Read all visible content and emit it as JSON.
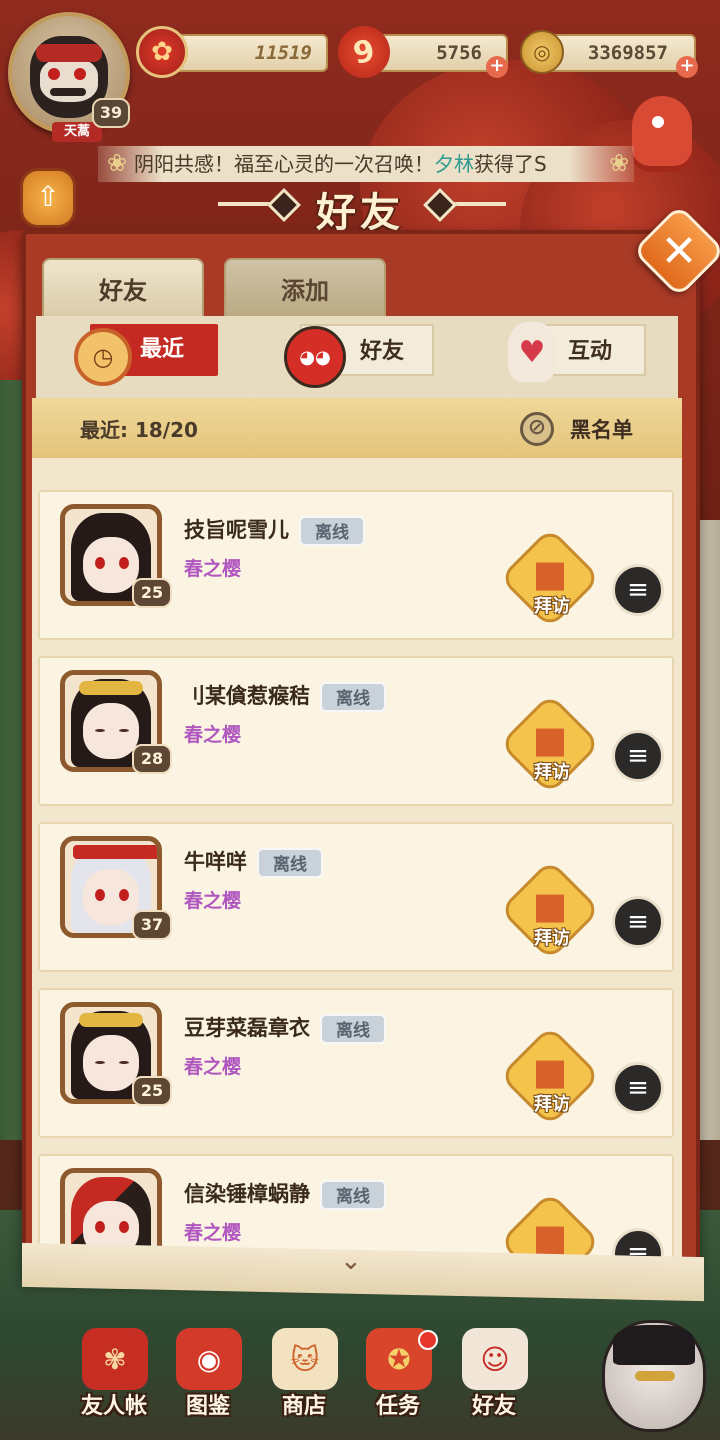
{
  "player": {
    "level": "39",
    "badge_text": "天蒿"
  },
  "resources": {
    "stamina": "11519",
    "magatama": "5756",
    "coins": "3369857",
    "magatama_glyph": "9",
    "coin_glyph": "◎",
    "plus": "+"
  },
  "ticker": {
    "text_before": "阴阳共感！福至心灵的一次召唤！",
    "highlight": "夕林",
    "text_after": "获得了S"
  },
  "title": "好友",
  "tabs": [
    {
      "label": "好友"
    },
    {
      "label": "添加"
    }
  ],
  "segments": [
    {
      "label": "最近",
      "icon": "clock-icon",
      "active": true
    },
    {
      "label": "好友",
      "icon": "daruma-icon",
      "active": false
    },
    {
      "label": "互动",
      "icon": "doll-icon",
      "active": false
    }
  ],
  "recent": {
    "label": "最近:  18/20",
    "blacklist_label": "黑名单"
  },
  "friends": [
    {
      "name": "技旨呢雪儿",
      "status": "离线",
      "guild": "春之樱",
      "level": "25"
    },
    {
      "name": "刂某僋惹瘊秸",
      "status": "离线",
      "guild": "春之樱",
      "level": "28"
    },
    {
      "name": "牛咩咩",
      "status": "离线",
      "guild": "春之樱",
      "level": "37"
    },
    {
      "name": "豆芽菜磊章衣",
      "status": "离线",
      "guild": "春之樱",
      "level": "25"
    },
    {
      "name": "信染锤樟蜗静",
      "status": "离线",
      "guild": "春之樱",
      "level": ""
    }
  ],
  "visit_label": "拜访",
  "nav": [
    {
      "label": "友人帐"
    },
    {
      "label": "图鉴"
    },
    {
      "label": "商店"
    },
    {
      "label": "任务"
    },
    {
      "label": "好友"
    }
  ],
  "colors": {
    "panel": "#a83a26",
    "active_segment": "#c42a22",
    "guild_text": "#b057bf",
    "ticker_highlight": "#2f9a92"
  }
}
